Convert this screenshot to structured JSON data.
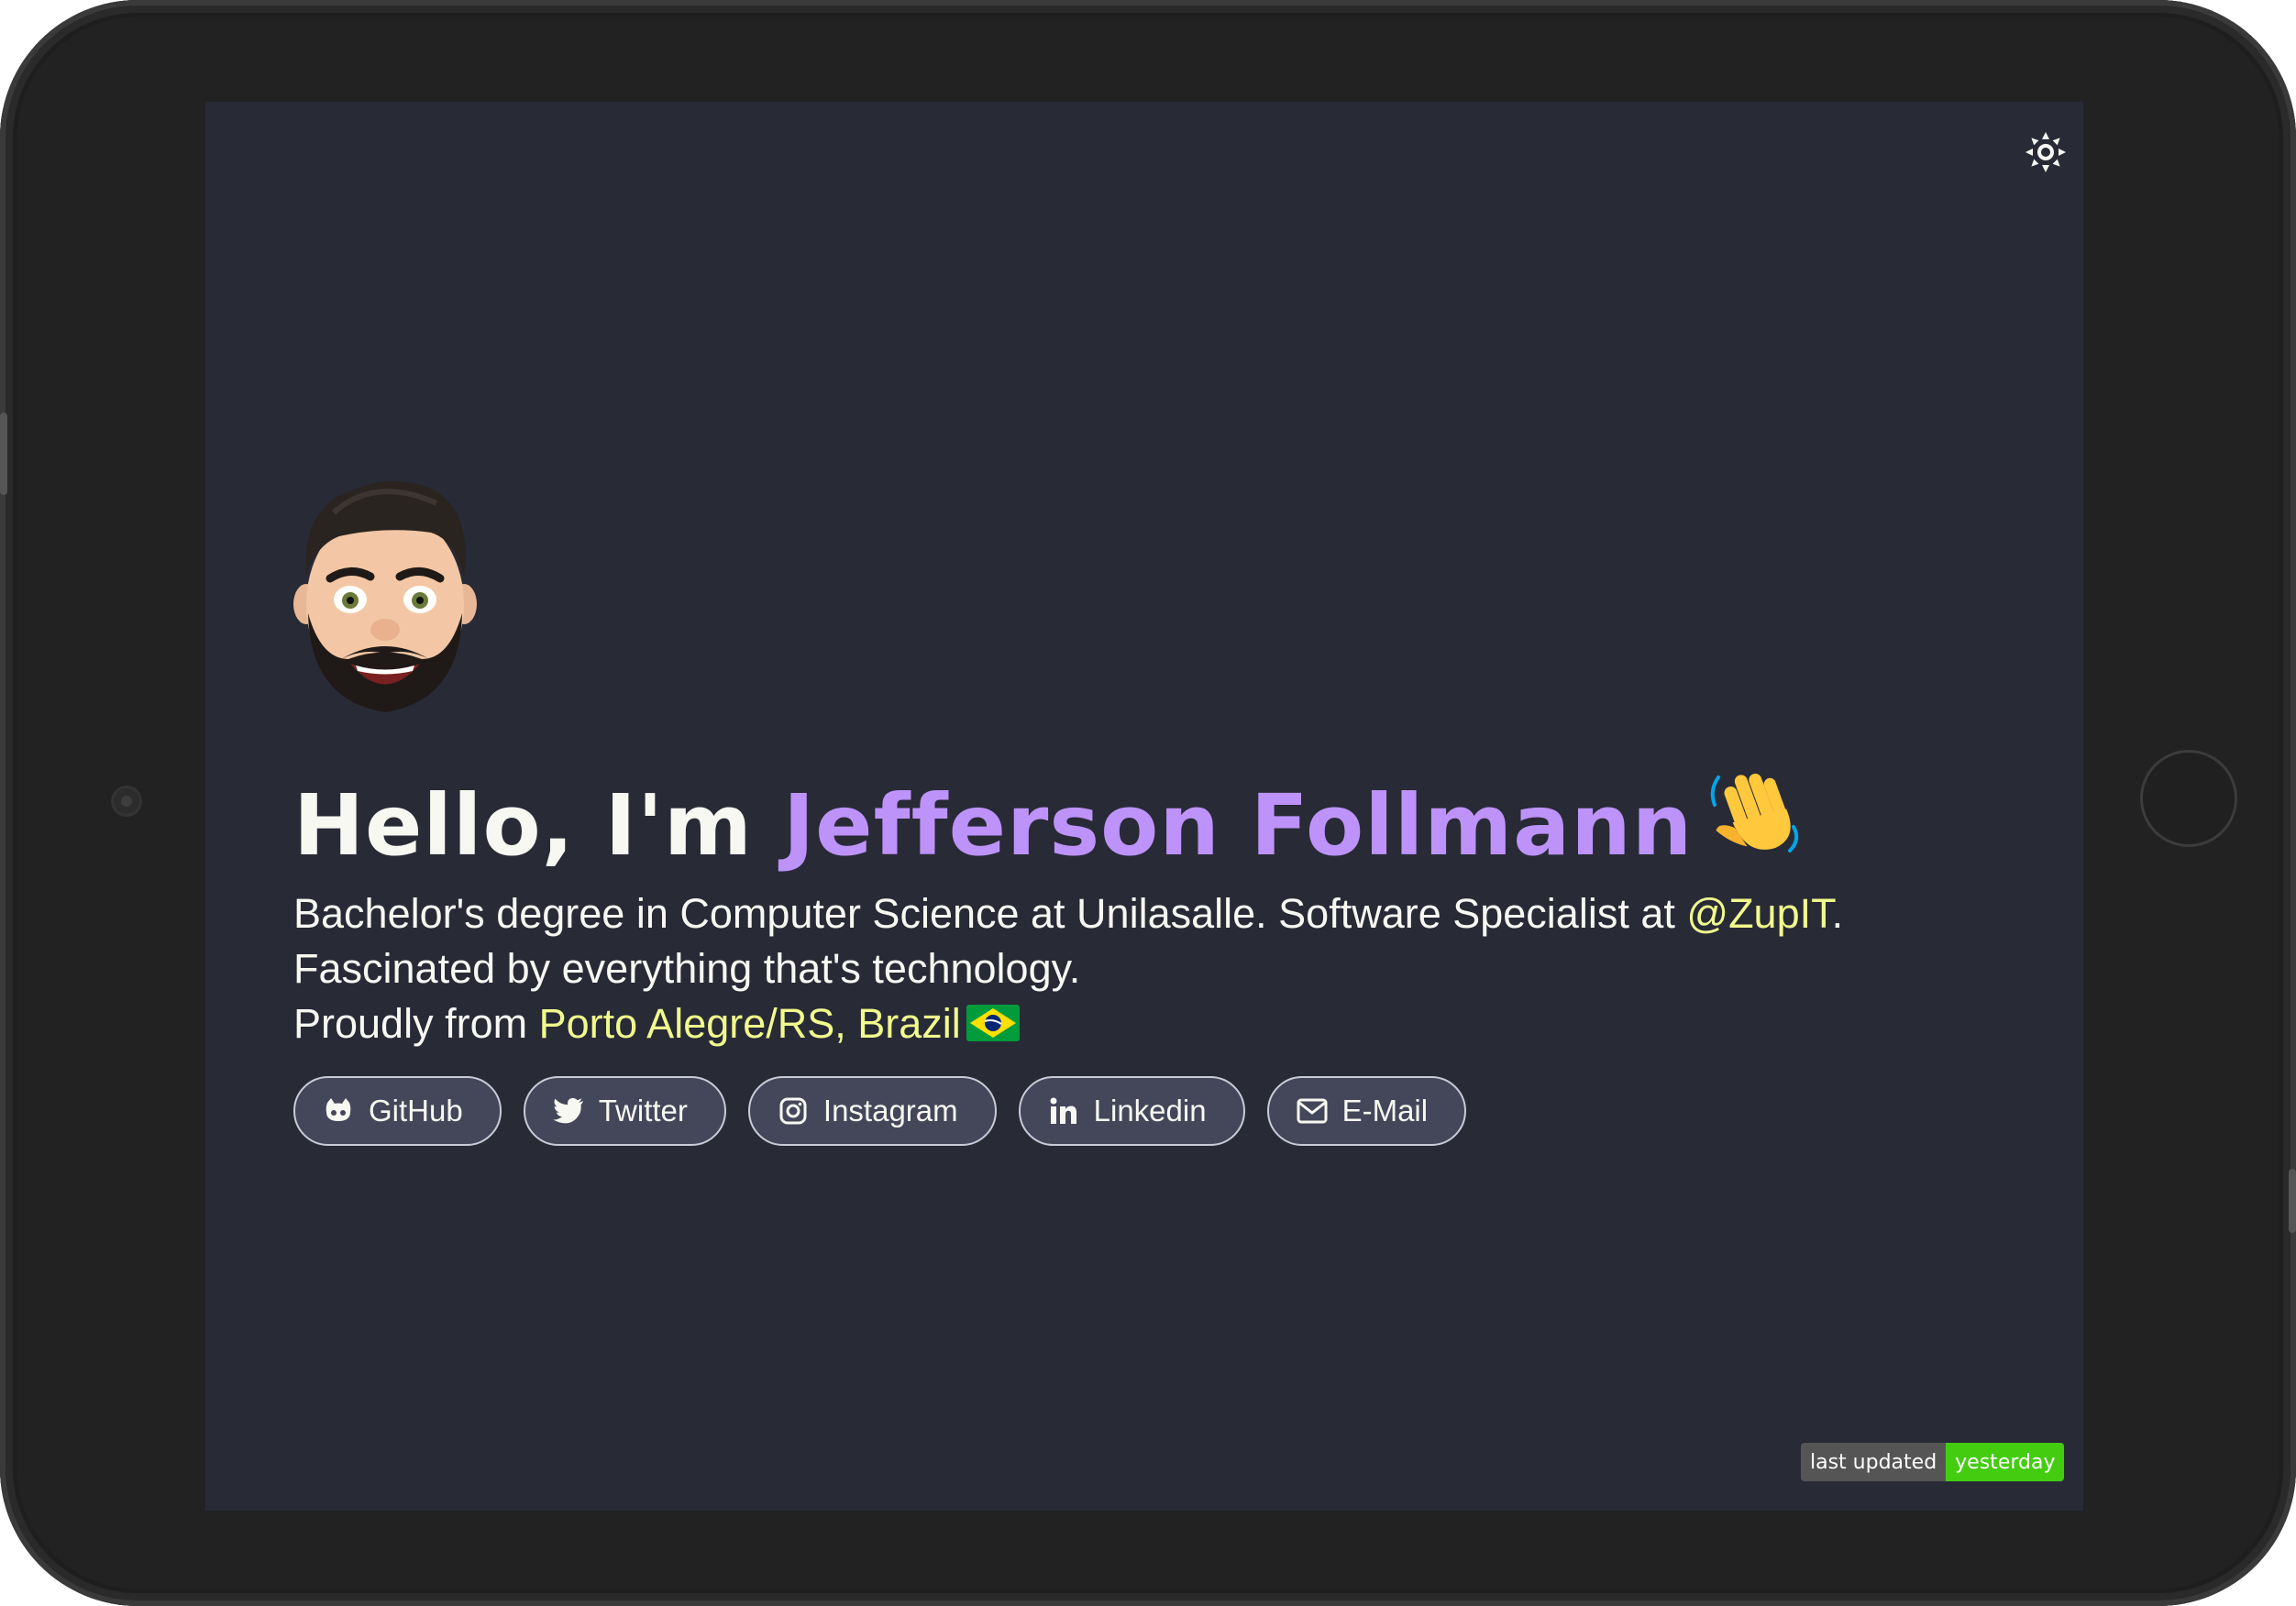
{
  "hero": {
    "greeting": "Hello, I'm",
    "name": "Jefferson Follmann"
  },
  "bio": {
    "line1_text": "Bachelor's degree in Computer Science at Unilasalle. Software Specialist at",
    "line1_link": "@ZupIT",
    "line1_end": ".",
    "line2": "Fascinated by everything that's technology.",
    "line3_text": "Proudly from",
    "line3_place": "Porto Alegre/RS, Brazil"
  },
  "links": [
    {
      "label": "GitHub",
      "icon": "github-icon"
    },
    {
      "label": "Twitter",
      "icon": "twitter-icon"
    },
    {
      "label": "Instagram",
      "icon": "instagram-icon"
    },
    {
      "label": "Linkedin",
      "icon": "linkedin-icon"
    },
    {
      "label": "E-Mail",
      "icon": "mail-icon"
    }
  ],
  "badge": {
    "label": "last updated",
    "value": "yesterday"
  },
  "colors": {
    "background": "#282a36",
    "accent_name": "#bd93f9",
    "highlight": "#f1fa8c",
    "button_bg": "#44475a",
    "text": "#f8f8f2"
  },
  "icons": {
    "theme_toggle": "sun-icon",
    "avatar": "memoji-avatar",
    "greeting_emoji": "waving-hand-icon",
    "flag": "brazil-flag-icon"
  }
}
